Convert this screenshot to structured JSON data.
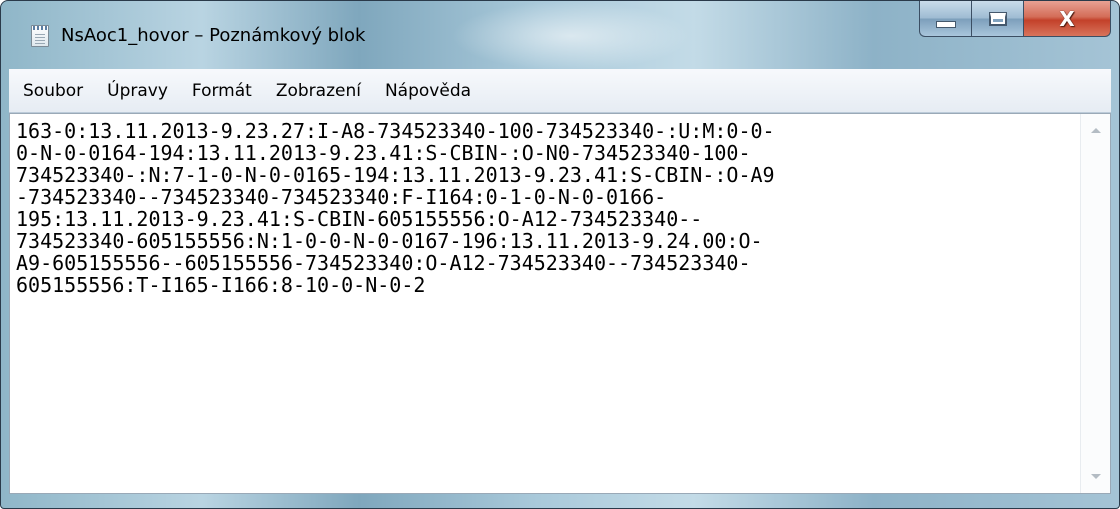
{
  "window": {
    "title": "NsAoc1_hovor – Poznámkový blok",
    "icon": "notepad-icon",
    "caption_buttons": {
      "minimize_icon": "minimize-icon",
      "maximize_icon": "maximize-icon",
      "close_icon": "close-icon",
      "close_glyph": "X",
      "close_color": "#c3412a"
    }
  },
  "menu": {
    "items": [
      {
        "label": "Soubor"
      },
      {
        "label": "Úpravy"
      },
      {
        "label": "Formát"
      },
      {
        "label": "Zobrazení"
      },
      {
        "label": "Nápověda"
      }
    ]
  },
  "document": {
    "lines": [
      "163-0:13.11.2013-9.23.27:I-A8-734523340-100-734523340-:U:M:0-0-",
      "0-N-0-0164-194:13.11.2013-9.23.41:S-CBIN-:O-N0-734523340-100-",
      "734523340-:N:7-1-0-N-0-0165-194:13.11.2013-9.23.41:S-CBIN-:O-A9",
      "-734523340--734523340-734523340:F-I164:0-1-0-N-0-0166-",
      "195:13.11.2013-9.23.41:S-CBIN-605155556:O-A12-734523340--",
      "734523340-605155556:N:1-0-0-N-0-0167-196:13.11.2013-9.24.00:O-",
      "A9-605155556--605155556-734523340:O-A12-734523340--734523340-",
      "605155556:T-I165-I166:8-10-0-N-0-2"
    ]
  },
  "scrollbar": {
    "up_icon": "scroll-up-arrow-icon",
    "down_icon": "scroll-down-arrow-icon"
  }
}
